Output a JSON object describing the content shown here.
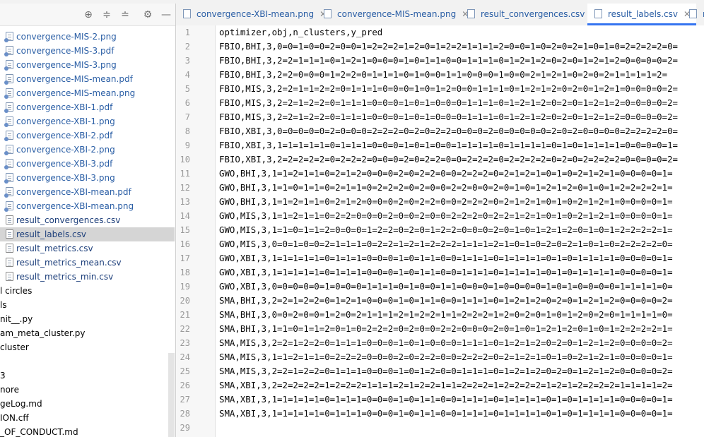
{
  "tabs": [
    {
      "label": "convergence-XBI-mean.png",
      "active": false
    },
    {
      "label": "convergence-MIS-mean.png",
      "active": false
    },
    {
      "label": "result_convergences.csv",
      "active": false
    },
    {
      "label": "result_labels.csv",
      "active": true
    },
    {
      "label": "re",
      "active": false
    }
  ],
  "tree": [
    {
      "label": "convergence-MIS-2.png",
      "icon": "png-file-icon"
    },
    {
      "label": "convergence-MIS-3.pdf",
      "icon": "pdf-file-icon"
    },
    {
      "label": "convergence-MIS-3.png",
      "icon": "png-file-icon"
    },
    {
      "label": "convergence-MIS-mean.pdf",
      "icon": "pdf-file-icon"
    },
    {
      "label": "convergence-MIS-mean.png",
      "icon": "png-file-icon"
    },
    {
      "label": "convergence-XBI-1.pdf",
      "icon": "pdf-file-icon"
    },
    {
      "label": "convergence-XBI-1.png",
      "icon": "png-file-icon"
    },
    {
      "label": "convergence-XBI-2.pdf",
      "icon": "pdf-file-icon"
    },
    {
      "label": "convergence-XBI-2.png",
      "icon": "png-file-icon"
    },
    {
      "label": "convergence-XBI-3.pdf",
      "icon": "pdf-file-icon"
    },
    {
      "label": "convergence-XBI-3.png",
      "icon": "png-file-icon"
    },
    {
      "label": "convergence-XBI-mean.pdf",
      "icon": "pdf-file-icon"
    },
    {
      "label": "convergence-XBI-mean.png",
      "icon": "png-file-icon"
    },
    {
      "label": "result_convergences.csv",
      "icon": "csv-file-icon"
    },
    {
      "label": "result_labels.csv",
      "icon": "csv-file-icon",
      "selected": true
    },
    {
      "label": "result_metrics.csv",
      "icon": "csv-file-icon"
    },
    {
      "label": "result_metrics_mean.csv",
      "icon": "csv-file-icon"
    },
    {
      "label": "result_metrics_min.csv",
      "icon": "csv-file-icon"
    },
    {
      "label": "l circles",
      "icon": "folder-icon",
      "cut": true
    },
    {
      "label": "ls",
      "icon": "",
      "cut": true
    },
    {
      "label": "nit__.py",
      "icon": "",
      "cut": true
    },
    {
      "label": "am_meta_cluster.py",
      "icon": "",
      "cut": true
    },
    {
      "label": "cluster",
      "icon": "",
      "cut": true
    },
    {
      "label": "",
      "icon": "",
      "cut": true
    },
    {
      "label": "3",
      "icon": "",
      "cut": true
    },
    {
      "label": "nore",
      "icon": "",
      "cut": true
    },
    {
      "label": "geLog.md",
      "icon": "",
      "cut": true
    },
    {
      "label": "ION.cff",
      "icon": "",
      "cut": true
    },
    {
      "label": "_OF_CONDUCT.md",
      "icon": "",
      "cut": true
    }
  ],
  "editor": {
    "lines": [
      "optimizer,obj,n_clusters,y_pred",
      "FBIO,BHI,3,0=0=1=0=0=2=0=0=1=2=2=2=1=2=0=1=2=2=1=1=1=2=0=0=1=0=2=0=2=1=0=1=0=2=2=2=2=0=",
      "FBIO,BHI,3,2=2=1=1=1=0=1=2=1=0=0=0=1=0=1=1=0=0=1=1=1=0=1=2=1=2=0=2=0=1=2=1=2=0=0=0=0=2=",
      "FBIO,BHI,3,2=2=0=0=0=1=2=2=0=1=1=1=0=1=0=0=1=1=0=0=0=1=0=0=2=1=2=1=0=2=0=2=1=1=1=1=2=",
      "FBIO,MIS,3,2=2=1=1=2=2=0=1=1=1=0=0=0=1=0=1=2=0=0=1=1=1=0=1=2=1=2=0=2=0=1=2=1=0=0=0=0=2=",
      "FBIO,MIS,3,2=2=1=2=2=0=1=1=1=0=0=0=1=0=1=0=0=0=1=1=1=0=1=2=1=2=0=2=0=1=2=1=2=0=0=0=0=2=",
      "FBIO,MIS,3,2=2=1=2=2=0=1=1=1=0=0=0=1=0=1=0=0=0=1=1=1=0=1=2=1=2=0=2=0=1=2=1=2=0=0=0=0=2=",
      "FBIO,XBI,3,0=0=0=0=0=2=0=0=0=2=2=2=0=2=0=2=2=0=0=0=2=0=0=0=0=0=2=0=2=0=0=0=0=2=2=2=2=0=",
      "FBIO,XBI,3,1=1=1=1=1=0=1=1=1=0=0=0=1=0=1=0=0=1=1=1=1=0=1=1=1=1=0=1=0=1=1=1=1=0=0=0=0=1=",
      "FBIO,XBI,3,2=2=2=2=2=0=2=2=2=0=0=0=2=0=2=2=0=0=2=2=2=0=2=2=2=2=0=2=0=2=2=2=2=0=0=0=0=2=",
      "GWO,BHI,3,1=1=2=1=1=0=2=1=2=0=0=0=2=0=2=2=0=0=2=2=2=0=2=1=2=1=0=1=0=2=1=2=1=0=0=0=0=1=",
      "GWO,BHI,3,1=1=0=1=1=0=2=1=1=0=2=2=2=0=2=0=0=2=2=0=0=2=0=1=0=1=2=1=2=0=1=0=1=2=2=2=2=1=",
      "GWO,BHI,3,1=1=2=1=1=0=2=1=2=0=0=0=2=0=2=2=0=0=2=2=2=0=2=1=2=1=0=1=0=2=1=2=1=0=0=0=0=1=",
      "GWO,MIS,3,1=1=2=1=1=0=2=2=0=0=0=2=0=0=2=0=0=2=2=2=0=2=2=1=2=1=0=1=0=2=1=2=1=0=0=0=0=1=",
      "GWO,MIS,3,1=1=0=1=1=2=0=0=0=1=2=2=0=2=0=1=2=2=0=0=0=2=0=1=0=1=2=1=2=0=1=0=1=2=2=2=2=1=",
      "GWO,MIS,3,0=0=1=0=0=2=1=1=1=0=2=2=1=2=1=2=2=2=1=1=1=2=1=0=1=0=2=0=2=1=0=1=0=2=2=2=2=0=",
      "GWO,XBI,3,1=1=1=1=1=0=1=1=1=0=0=0=1=0=1=1=0=0=1=1=1=0=1=1=1=1=0=1=0=1=1=1=1=0=0=0=0=1=",
      "GWO,XBI,3,1=1=1=1=1=0=1=1=1=0=0=0=1=0=1=1=0=0=1=1=1=0=1=1=1=1=0=1=0=1=1=1=1=0=0=0=0=1=",
      "GWO,XBI,3,0=0=0=0=0=1=0=0=0=1=1=1=0=1=0=0=1=1=0=0=0=1=0=0=0=0=1=0=1=0=0=0=0=1=1=1=1=0=",
      "SMA,BHI,3,2=2=1=2=2=0=1=2=1=0=0=0=1=0=1=1=0=0=1=1=1=0=1=2=1=2=0=2=0=1=2=1=2=0=0=0=0=2=",
      "SMA,BHI,3,0=0=2=0=0=1=2=0=2=1=1=1=2=1=2=2=1=1=2=2=2=1=2=0=2=0=1=0=1=2=0=2=0=1=1=1=1=0=",
      "SMA,BHI,3,1=1=0=1=1=2=0=1=0=2=2=2=0=2=0=0=2=2=0=0=0=2=0=1=0=1=2=1=2=0=1=0=1=2=2=2=2=1=",
      "SMA,MIS,3,2=2=1=2=2=0=1=1=1=0=0=0=1=0=1=0=0=0=1=1=1=0=1=2=1=2=0=2=0=1=2=1=2=0=0=0=0=2=",
      "SMA,MIS,3,1=1=2=1=1=0=2=2=2=0=0=0=2=0=2=2=0=0=2=2=2=0=2=1=2=1=0=1=0=2=1=2=1=0=0=0=0=1=",
      "SMA,MIS,3,2=2=1=2=2=0=1=1=1=0=0=0=1=0=1=2=0=0=1=1=1=0=1=2=1=2=0=2=0=1=2=1=2=0=0=0=0=2=",
      "SMA,XBI,3,2=2=2=2=2=1=2=2=2=1=1=1=2=1=2=2=1=1=2=2=2=1=2=2=2=2=1=2=1=2=2=2=2=1=1=1=1=2=",
      "SMA,XBI,3,1=1=1=1=1=0=1=1=1=0=0=0=1=0=1=1=0=0=1=1=1=0=1=1=1=1=0=1=0=1=1=1=1=0=0=0=0=1=",
      "SMA,XBI,3,1=1=1=1=1=0=1=1=1=0=0=0=1=0=1=1=0=0=1=1=1=0=1=1=1=1=0=1=0=1=1=1=1=0=0=0=0=1=",
      ""
    ]
  },
  "colors": {
    "link": "#2a5ea5",
    "active_tab_underline": "#3574f0",
    "selection": "#d5d5d5"
  }
}
